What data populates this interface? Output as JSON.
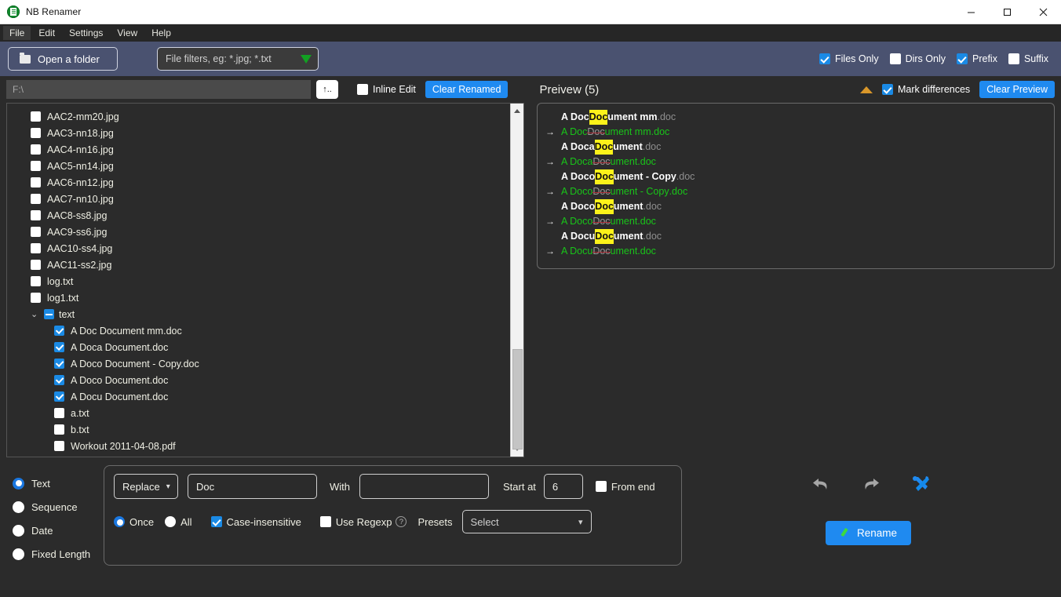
{
  "window": {
    "title": "NB Renamer",
    "app_icon": "nb-renamer-logo",
    "minimize": "minimize-icon",
    "maximize": "maximize-icon",
    "close": "close-icon"
  },
  "menubar": [
    "File",
    "Edit",
    "Settings",
    "View",
    "Help"
  ],
  "toolbar": {
    "open_folder_label": "Open a folder",
    "folder_icon": "folder-icon",
    "filter_placeholder": "File filters, eg: *.jpg; *.txt",
    "filter_value": "",
    "funnel_icon": "funnel-icon",
    "checks": [
      {
        "label": "Files Only",
        "checked": true
      },
      {
        "label": "Dirs Only",
        "checked": false
      },
      {
        "label": "Prefix",
        "checked": true
      },
      {
        "label": "Suffix",
        "checked": false
      }
    ]
  },
  "pathbar": {
    "path_placeholder": "F:\\",
    "path_value": "",
    "up_button": "↑..",
    "inline_edit_label": "Inline Edit",
    "inline_edit_checked": false,
    "clear_renamed_label": "Clear Renamed",
    "preview_title": "Preivew (5)",
    "collapse_icon": "triangle-up-icon",
    "mark_differences_label": "Mark differences",
    "mark_differences_checked": true,
    "clear_preview_label": "Clear Preview"
  },
  "tree": {
    "items": [
      {
        "name": "AAC2-mm20.jpg",
        "type": "file",
        "checked": false,
        "indent": 1
      },
      {
        "name": "AAC3-nn18.jpg",
        "type": "file",
        "checked": false,
        "indent": 1
      },
      {
        "name": "AAC4-nn16.jpg",
        "type": "file",
        "checked": false,
        "indent": 1
      },
      {
        "name": "AAC5-nn14.jpg",
        "type": "file",
        "checked": false,
        "indent": 1
      },
      {
        "name": "AAC6-nn12.jpg",
        "type": "file",
        "checked": false,
        "indent": 1
      },
      {
        "name": "AAC7-nn10.jpg",
        "type": "file",
        "checked": false,
        "indent": 1
      },
      {
        "name": "AAC8-ss8.jpg",
        "type": "file",
        "checked": false,
        "indent": 1
      },
      {
        "name": "AAC9-ss6.jpg",
        "type": "file",
        "checked": false,
        "indent": 1
      },
      {
        "name": "AAC10-ss4.jpg",
        "type": "file",
        "checked": false,
        "indent": 1
      },
      {
        "name": "AAC11-ss2.jpg",
        "type": "file",
        "checked": false,
        "indent": 1
      },
      {
        "name": "log.txt",
        "type": "file",
        "checked": false,
        "indent": 1
      },
      {
        "name": "log1.txt",
        "type": "file",
        "checked": false,
        "indent": 1
      },
      {
        "name": "text",
        "type": "folder",
        "checked": "indeterminate",
        "indent": 0,
        "expanded": true
      },
      {
        "name": "A Doc Document mm.doc",
        "type": "file",
        "checked": true,
        "indent": 2
      },
      {
        "name": "A Doca Document.doc",
        "type": "file",
        "checked": true,
        "indent": 2
      },
      {
        "name": "A Doco Document - Copy.doc",
        "type": "file",
        "checked": true,
        "indent": 2
      },
      {
        "name": "A Doco Document.doc",
        "type": "file",
        "checked": true,
        "indent": 2
      },
      {
        "name": "A Docu Document.doc",
        "type": "file",
        "checked": true,
        "indent": 2
      },
      {
        "name": "a.txt",
        "type": "file",
        "checked": false,
        "indent": 2
      },
      {
        "name": "b.txt",
        "type": "file",
        "checked": false,
        "indent": 2
      },
      {
        "name": "Workout 2011-04-08.pdf",
        "type": "file",
        "checked": false,
        "indent": 2
      }
    ]
  },
  "preview": {
    "pairs": [
      {
        "source": {
          "before": "A Doc ",
          "match": "Doc",
          "after": "ument mm",
          "ext": ".doc"
        },
        "result": {
          "before": "A Doc ",
          "removed": "Doc",
          "after": "ument mm",
          "ext": ".doc"
        }
      },
      {
        "source": {
          "before": "A Doca ",
          "match": "Doc",
          "after": "ument",
          "ext": ".doc"
        },
        "result": {
          "before": "A Doca ",
          "removed": "Doc",
          "after": "ument",
          "ext": ".doc"
        }
      },
      {
        "source": {
          "before": "A Doco ",
          "match": "Doc",
          "after": "ument - Copy",
          "ext": ".doc"
        },
        "result": {
          "before": "A Doco ",
          "removed": "Doc",
          "after": "ument - Copy",
          "ext": ".doc"
        }
      },
      {
        "source": {
          "before": "A Doco ",
          "match": "Doc",
          "after": "ument",
          "ext": ".doc"
        },
        "result": {
          "before": "A Doco ",
          "removed": "Doc",
          "after": "ument",
          "ext": ".doc"
        }
      },
      {
        "source": {
          "before": "A Docu ",
          "match": "Doc",
          "after": "ument",
          "ext": ".doc"
        },
        "result": {
          "before": "A Docu ",
          "removed": "Doc",
          "after": "ument",
          "ext": ".doc"
        }
      }
    ],
    "arrow_icon": "arrow-right-icon"
  },
  "modes": [
    {
      "label": "Text",
      "selected": true
    },
    {
      "label": "Sequence",
      "selected": false
    },
    {
      "label": "Date",
      "selected": false
    },
    {
      "label": "Fixed Length",
      "selected": false
    }
  ],
  "options": {
    "operation_value": "Replace",
    "operation_caret": "chevron-down-icon",
    "find_value": "Doc",
    "find_placeholder": "",
    "with_label": "With",
    "with_value": "",
    "with_placeholder": "",
    "start_at_label": "Start at",
    "start_at_value": "6",
    "from_end_label": "From end",
    "from_end_checked": false,
    "once_label": "Once",
    "once_selected": true,
    "all_label": "All",
    "all_selected": false,
    "case_insensitive_label": "Case-insensitive",
    "case_insensitive_checked": true,
    "use_regexp_label": "Use Regexp",
    "use_regexp_checked": false,
    "help_icon": "question-mark-icon",
    "presets_label": "Presets",
    "presets_value": "Select",
    "presets_caret": "chevron-down-icon"
  },
  "actions": {
    "undo_icon": "undo-arrow-icon",
    "redo_icon": "redo-arrow-icon",
    "tools_icon": "tools-icon",
    "rename_label": "Rename",
    "rename_icon": "pencil-icon"
  },
  "colors": {
    "accent_blue": "#1f8af0",
    "toolbar_blue": "#4a5270",
    "highlight_yellow": "#fcf21a",
    "result_green": "#19c419",
    "strike_red": "#b0303a",
    "background": "#2b2b2b"
  }
}
